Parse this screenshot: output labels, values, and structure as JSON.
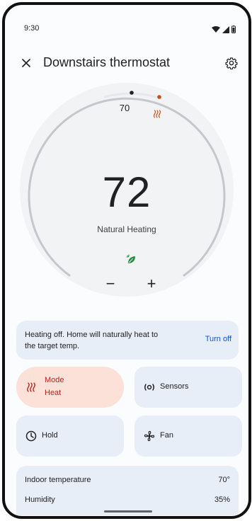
{
  "status_bar": {
    "time": "9:30"
  },
  "header": {
    "title": "Downstairs thermostat",
    "close_icon": "close-icon",
    "settings_icon": "gear-icon"
  },
  "dial": {
    "setpoint": "70",
    "current_temp": "72",
    "mode_status": "Natural Heating",
    "minus_label": "−",
    "plus_label": "+"
  },
  "info": {
    "message": "Heating off. Home will naturally heat to the target temp.",
    "action": "Turn off"
  },
  "tiles": {
    "mode_label": "Mode",
    "mode_value": "Heat",
    "sensors_label": "Sensors",
    "hold_label": "Hold",
    "fan_label": "Fan"
  },
  "stats": {
    "indoor_label": "Indoor temperature",
    "indoor_value": "70°",
    "humidity_label": "Humidity",
    "humidity_value": "35%"
  },
  "colors": {
    "heat_accent": "#b3261e",
    "mode_tile_bg": "#fbe1d7",
    "card_bg": "#e8eef7",
    "link": "#0b57d0",
    "eco_leaf": "#1e8e3e"
  }
}
